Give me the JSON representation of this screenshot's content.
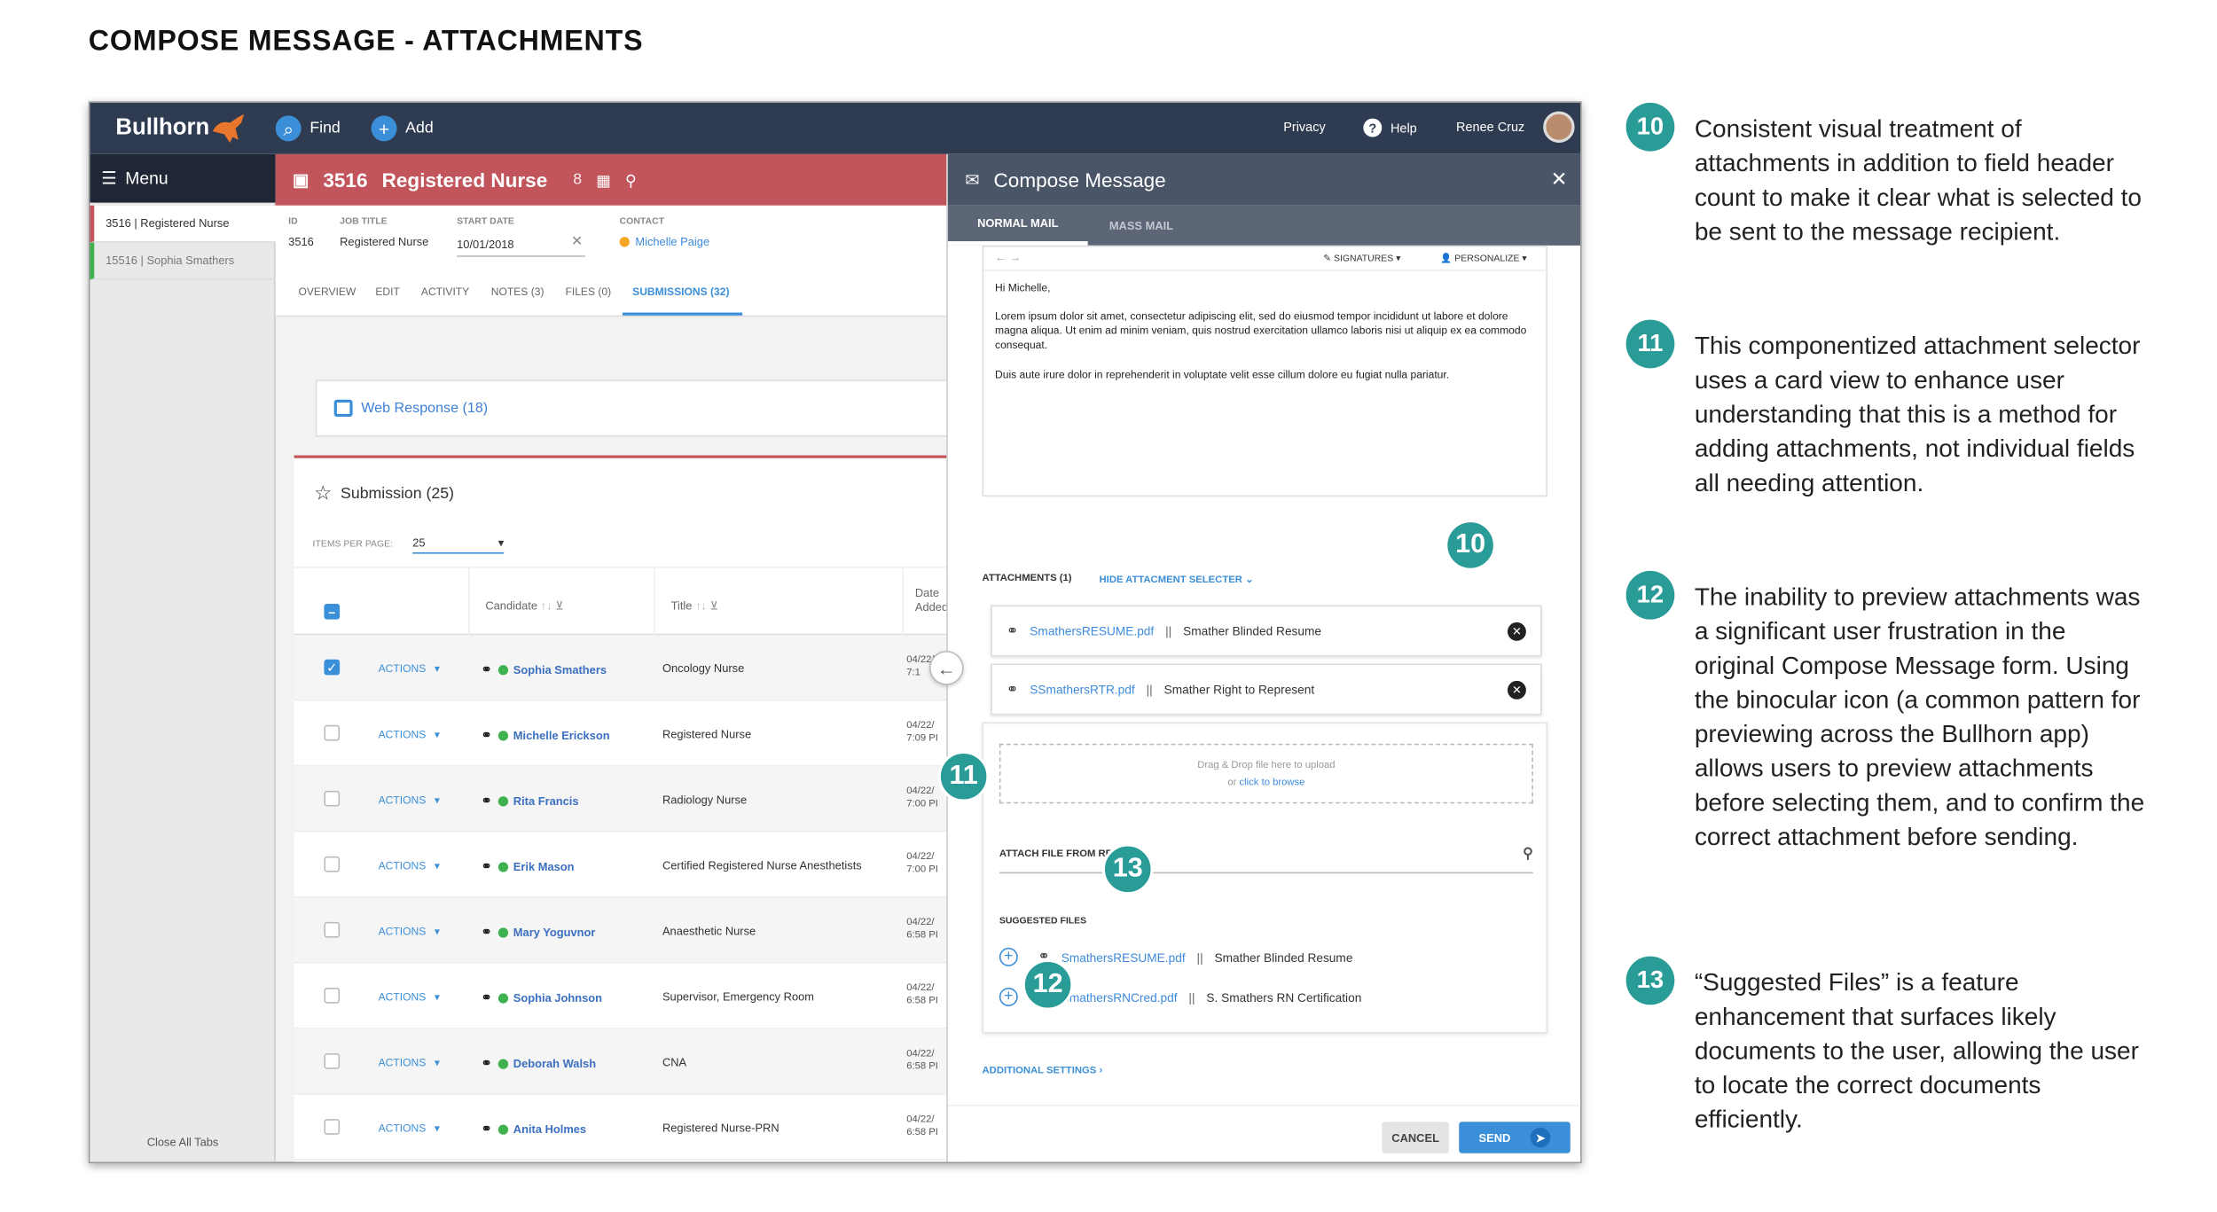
{
  "page": {
    "title": "COMPOSE MESSAGE - ATTACHMENTS"
  },
  "topbar": {
    "logo": "Bullhorn",
    "find": "Find",
    "add": "Add",
    "privacy": "Privacy",
    "help": "Help",
    "user": "Renee Cruz"
  },
  "sidebar": {
    "menu": "Menu",
    "items": [
      "3516 | Registered Nurse",
      "15516 | Sophia Smathers"
    ],
    "close_all": "Close All Tabs"
  },
  "record": {
    "id": "3516",
    "title": "Registered Nurse",
    "fields": {
      "id_label": "ID",
      "id_value": "3516",
      "job_label": "JOB TITLE",
      "job_value": "Registered Nurse",
      "start_label": "START DATE",
      "start_value": "10/01/2018",
      "contact_label": "CONTACT",
      "contact_value": "Michelle Paige"
    },
    "tabs": [
      "OVERVIEW",
      "EDIT",
      "ACTIVITY",
      "NOTES (3)",
      "FILES (0)",
      "SUBMISSIONS (32)"
    ]
  },
  "web_response": "Web Response (18)",
  "submissions": {
    "title": "Submission (25)",
    "items_per_page_label": "ITEMS PER PAGE:",
    "items_per_page": "25",
    "col_candidate": "Candidate",
    "col_title": "Title",
    "col_date": "Date Added",
    "action_label": "ACTIONS",
    "rows": [
      {
        "name": "Sophia Smathers",
        "title": "Oncology Nurse",
        "date": "04/22/",
        "time": "7:1",
        "checked": true
      },
      {
        "name": "Michelle Erickson",
        "title": "Registered Nurse",
        "date": "04/22/",
        "time": "7:09 PI",
        "checked": false
      },
      {
        "name": "Rita Francis",
        "title": "Radiology Nurse",
        "date": "04/22/",
        "time": "7:00 PI",
        "checked": false
      },
      {
        "name": "Erik Mason",
        "title": "Certified Registered Nurse Anesthetists",
        "date": "04/22/",
        "time": "7:00 PI",
        "checked": false
      },
      {
        "name": "Mary Yoguvnor",
        "title": "Anaesthetic Nurse",
        "date": "04/22/",
        "time": "6:58 PI",
        "checked": false
      },
      {
        "name": "Sophia Johnson",
        "title": "Supervisor, Emergency Room",
        "date": "04/22/",
        "time": "6:58 PI",
        "checked": false
      },
      {
        "name": "Deborah Walsh",
        "title": "CNA",
        "date": "04/22/",
        "time": "6:58 PI",
        "checked": false
      },
      {
        "name": "Anita Holmes",
        "title": "Registered Nurse-PRN",
        "date": "04/22/",
        "time": "6:58 PI",
        "checked": false
      }
    ]
  },
  "compose": {
    "title": "Compose Message",
    "tab_normal": "NORMAL MAIL",
    "tab_mass": "MASS MAIL",
    "signatures": "SIGNATURES",
    "personalize": "PERSONALIZE",
    "greeting": "Hi Michelle,",
    "para1": "Lorem ipsum dolor sit amet, consectetur adipiscing elit, sed do eiusmod tempor incididunt ut labore et dolore magna aliqua. Ut enim ad minim veniam, quis nostrud exercitation ullamco laboris nisi ut aliquip ex ea commodo consequat.",
    "para2": "Duis aute irure dolor in reprehenderit in voluptate velit esse cillum dolore eu fugiat nulla pariatur.",
    "attachments_label": "ATTACHMENTS (1)",
    "hide_selector": "HIDE ATTACMENT SELECTER",
    "attachments": [
      {
        "file": "SmathersRESUME.pdf",
        "name": "Smather Blinded Resume"
      },
      {
        "file": "SSmathersRTR.pdf",
        "name": "Smather Right to Represent"
      }
    ],
    "separator": "||",
    "drop_text": "Drag & Drop file here to upload",
    "drop_or": "or",
    "drop_browse": "click to browse",
    "attach_from_record": "ATTACH FILE FROM RECORD",
    "suggested_label": "SUGGESTED FILES",
    "suggested": [
      {
        "file": "SmathersRESUME.pdf",
        "name": "Smather Blinded Resume"
      },
      {
        "file": "SmathersRNCred.pdf",
        "name": "S. Smathers RN Certification"
      }
    ],
    "additional_settings": "ADDITIONAL SETTINGS",
    "cancel": "CANCEL",
    "send": "SEND"
  },
  "callouts": {
    "c10": "10",
    "c11": "11",
    "c12": "12",
    "c13": "13"
  },
  "notes": [
    {
      "num": "10",
      "text": "Consistent visual treatment of attachments in addition to field header count to make it clear what is selected to be sent to the message recipient."
    },
    {
      "num": "11",
      "text": "This componentized attachment selector uses a card view to enhance user understanding that this is a method for adding attachments, not individual fields all needing attention."
    },
    {
      "num": "12",
      "text": "The inability to preview attachments was a significant user frustration in the original Compose Message form. Using the binocular icon (a common pattern for previewing across the Bullhorn app) allows users to preview attachments before selecting them, and to confirm the correct attachment before sending."
    },
    {
      "num": "13",
      "text": "“Suggested Files” is a feature enhancement that surfaces likely documents to the user, allowing the user to locate the correct documents efficiently."
    }
  ],
  "colors": {
    "accent": "#3b8fd8",
    "record_header": "#c2555b",
    "callout": "#2a9c98",
    "topbar": "#2f3b50"
  }
}
